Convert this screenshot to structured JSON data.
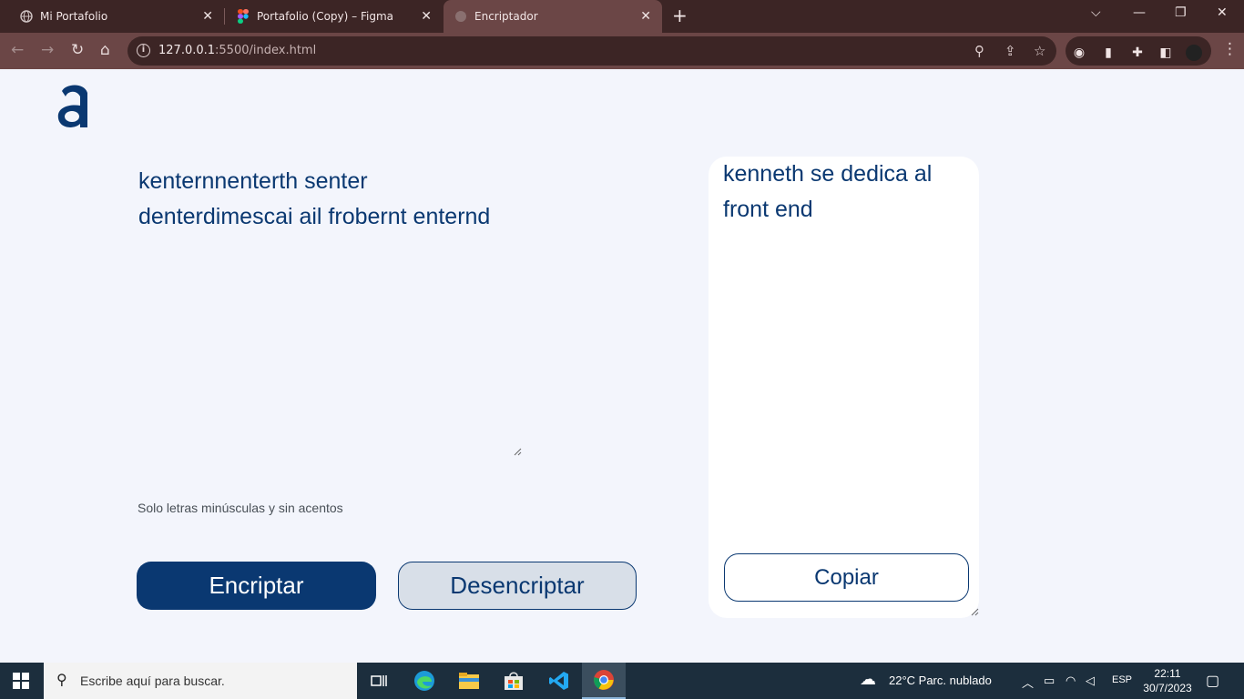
{
  "browser": {
    "tabs": [
      {
        "title": "Mi Portafolio"
      },
      {
        "title": "Portafolio (Copy) – Figma"
      },
      {
        "title": "Encriptador"
      }
    ],
    "url_host": "127.0.0.1",
    "url_path": ":5500/index.html"
  },
  "app": {
    "input_text": "kenternnenterth senter denterdimescai ail frobernt enternd",
    "hint": "Solo letras minúsculas y sin acentos",
    "encrypt_label": "Encriptar",
    "decrypt_label": "Desencriptar",
    "output_text": "kenneth se dedica al front end",
    "copy_label": "Copiar",
    "colors": {
      "primary": "#0a3871",
      "background": "#f3f5fc",
      "card": "#ffffff"
    }
  },
  "taskbar": {
    "search_placeholder": "Escribe aquí para buscar.",
    "weather": "22°C  Parc. nublado",
    "language": "ESP",
    "time": "22:11",
    "date": "30/7/2023"
  }
}
